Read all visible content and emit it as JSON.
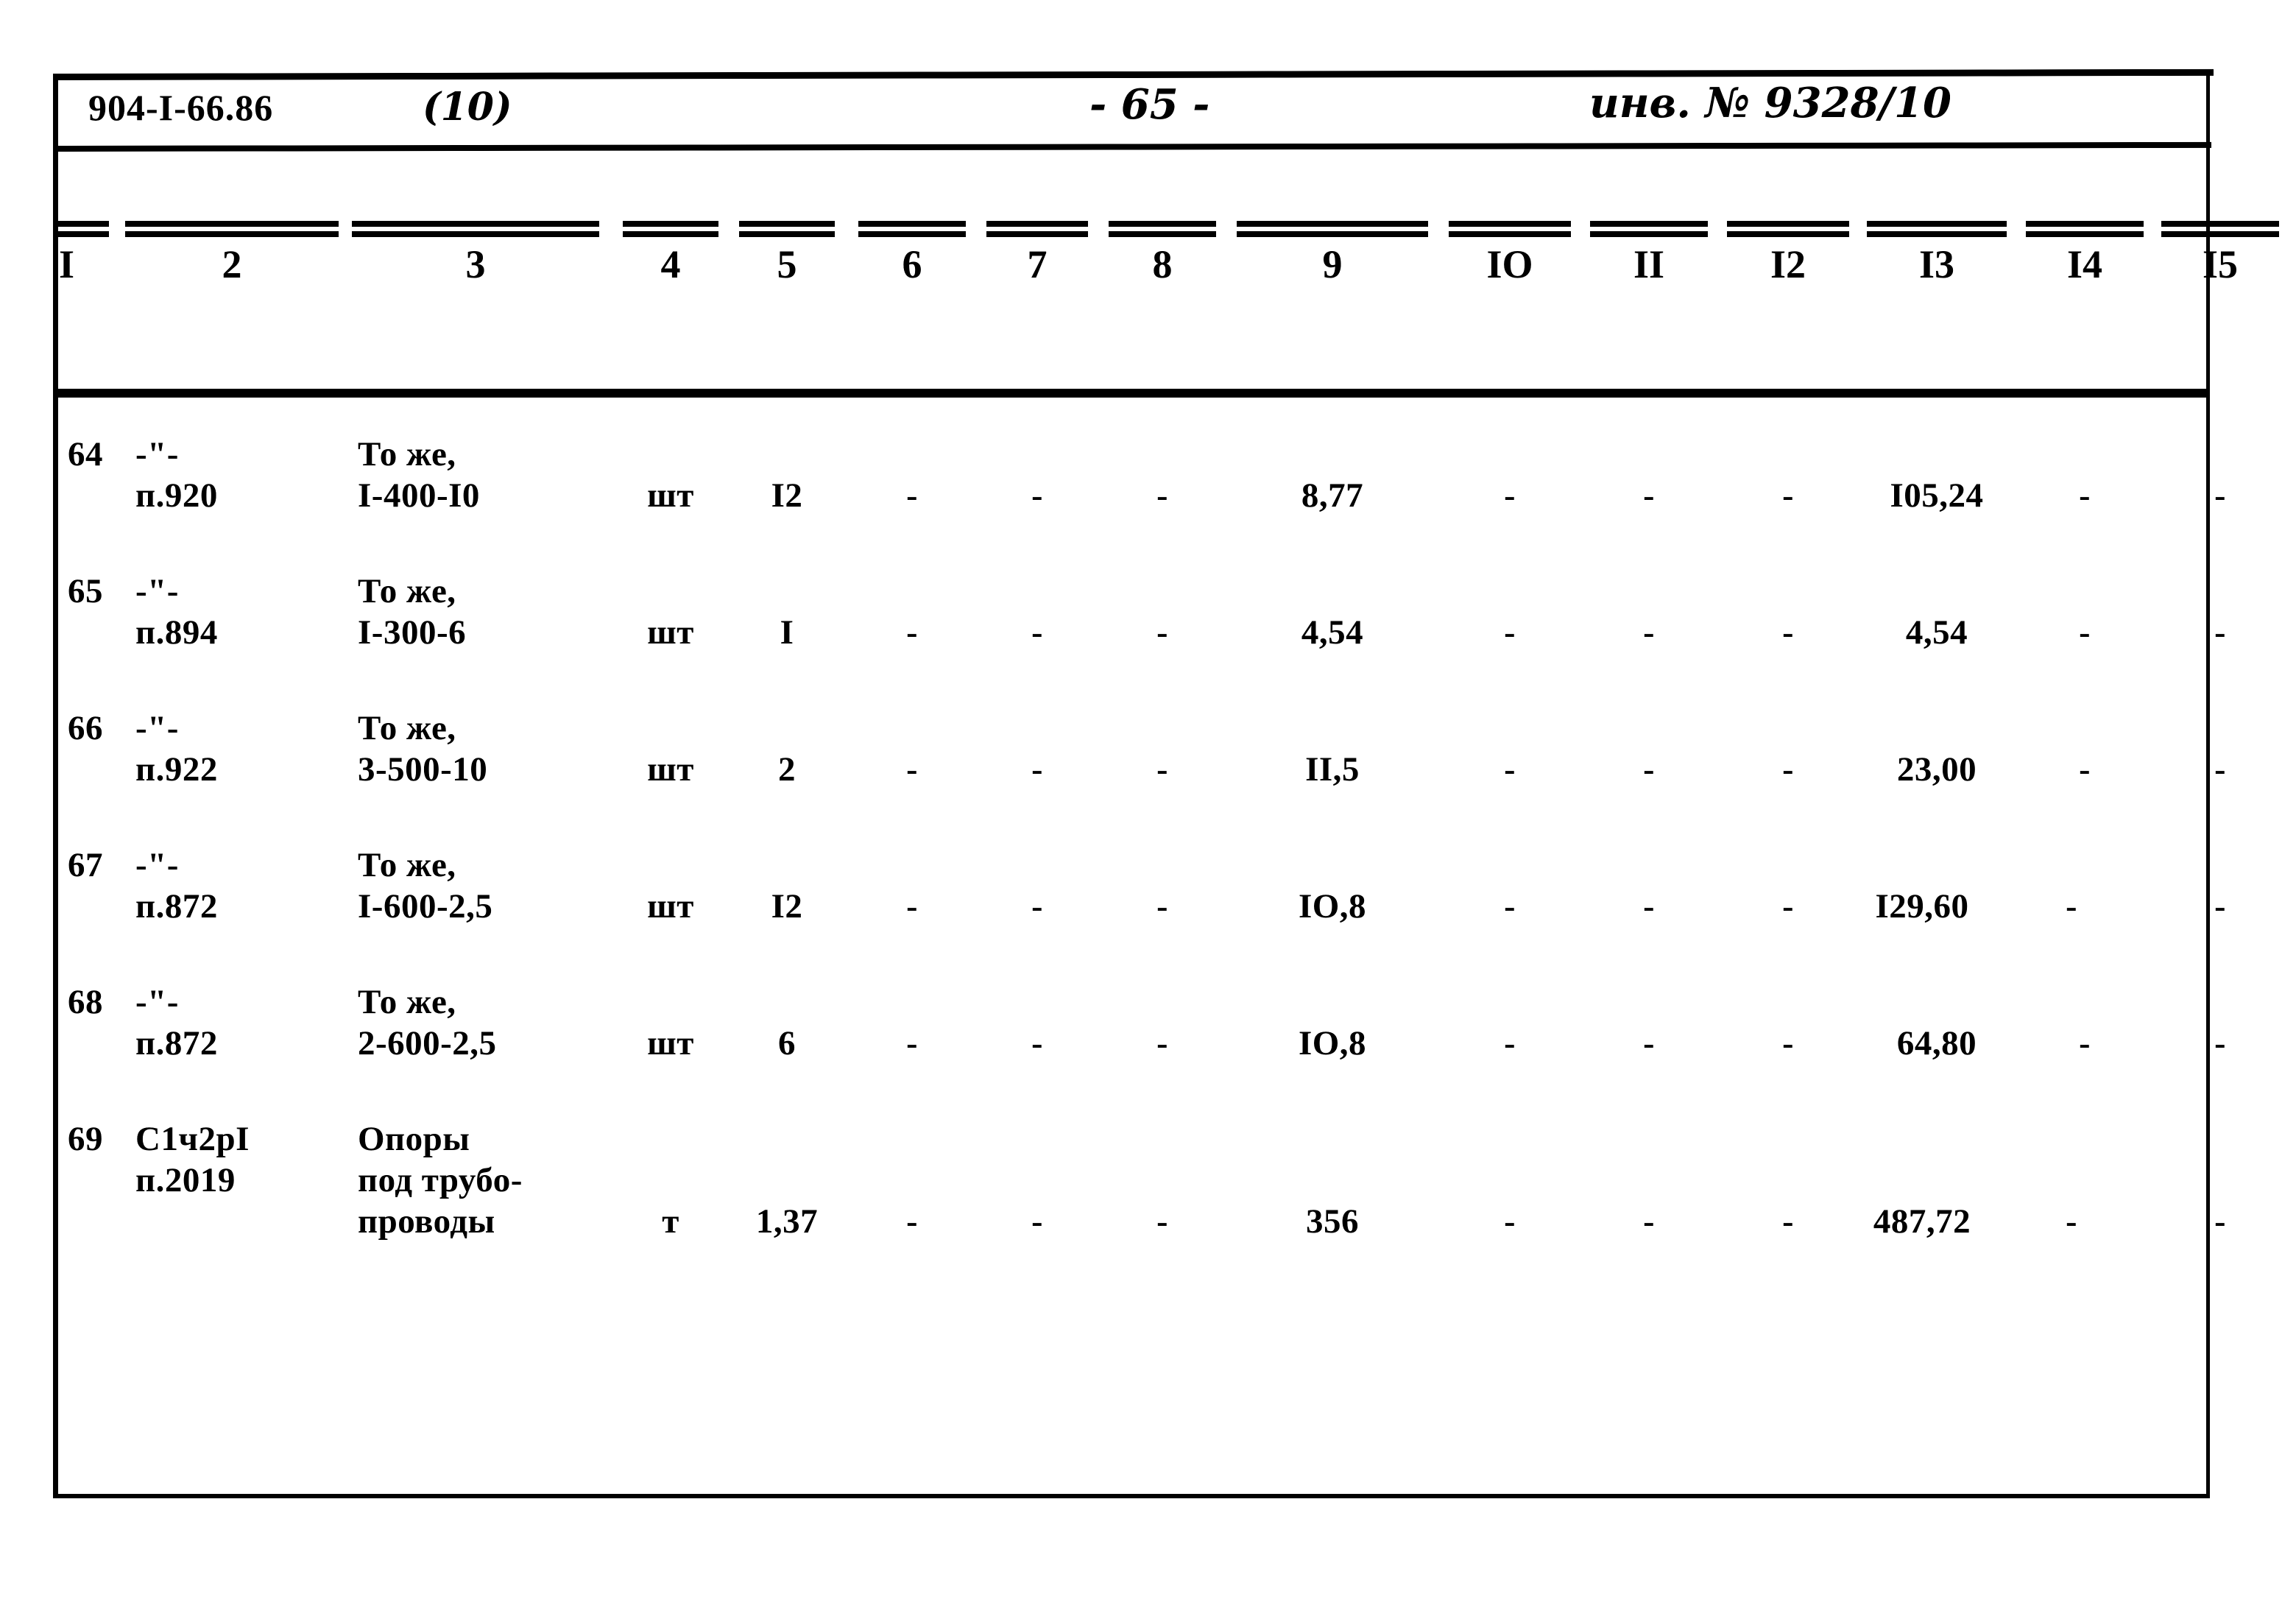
{
  "document": {
    "code": "904-I-66.86",
    "copy_marker": "(10)",
    "page_number": "- 65 -",
    "inventory_number": "инв. № 9328/10"
  },
  "table": {
    "column_numbers": [
      "I",
      "2",
      "3",
      "4",
      "5",
      "6",
      "7",
      "8",
      "9",
      "IO",
      "II",
      "I2",
      "I3",
      "I4",
      "I5"
    ],
    "rows": [
      {
        "c1": "64",
        "c2_line1": "-\"-",
        "c2_line2": "п.920",
        "c3_line1": "То же,",
        "c3_line2": "I-400-I0",
        "c3_line3": "",
        "c4": "шт",
        "c5": "I2",
        "c6": "-",
        "c7": "-",
        "c8": "-",
        "c9": "8,77",
        "c10": "-",
        "c11": "-",
        "c12": "-",
        "c13": "I05,24",
        "c14": "-",
        "c15": "-"
      },
      {
        "c1": "65",
        "c2_line1": "-\"-",
        "c2_line2": "п.894",
        "c3_line1": "То же,",
        "c3_line2": "I-300-6",
        "c3_line3": "",
        "c4": "шт",
        "c5": "I",
        "c6": "-",
        "c7": "-",
        "c8": "-",
        "c9": "4,54",
        "c10": "-",
        "c11": "-",
        "c12": "-",
        "c13": "4,54",
        "c14": "-",
        "c15": "-"
      },
      {
        "c1": "66",
        "c2_line1": "-\"-",
        "c2_line2": "п.922",
        "c3_line1": "То же,",
        "c3_line2": "3-500-10",
        "c3_line3": "",
        "c4": "шт",
        "c5": "2",
        "c6": "-",
        "c7": "-",
        "c8": "-",
        "c9": "II,5",
        "c10": "-",
        "c11": "-",
        "c12": "-",
        "c13": "23,00",
        "c14": "-",
        "c15": "-"
      },
      {
        "c1": "67",
        "c2_line1": "-\"-",
        "c2_line2": "п.872",
        "c3_line1": "То же,",
        "c3_line2": "I-600-2,5",
        "c3_line3": "",
        "c4": "шт",
        "c5": "I2",
        "c6": "-",
        "c7": "-",
        "c8": "-",
        "c9": "IO,8",
        "c10": "-",
        "c11": "-",
        "c12": "-",
        "c13": "I29,60",
        "c14": "-",
        "c15": "-"
      },
      {
        "c1": "68",
        "c2_line1": "-\"-",
        "c2_line2": "п.872",
        "c3_line1": "То же,",
        "c3_line2": "2-600-2,5",
        "c3_line3": "",
        "c4": "шт",
        "c5": "6",
        "c6": "-",
        "c7": "-",
        "c8": "-",
        "c9": "IO,8",
        "c10": "-",
        "c11": "-",
        "c12": "-",
        "c13": "64,80",
        "c14": "-",
        "c15": "-"
      },
      {
        "c1": "69",
        "c2_line1": "С1ч2рI",
        "c2_line2": "п.2019",
        "c3_line1": "Опоры",
        "c3_line2": "под трубо-",
        "c3_line3": "проводы",
        "c4": "т",
        "c5": "1,37",
        "c6": "-",
        "c7": "-",
        "c8": "-",
        "c9": "356",
        "c10": "-",
        "c11": "-",
        "c12": "-",
        "c13": "487,72",
        "c14": "-",
        "c15": "-"
      }
    ]
  }
}
